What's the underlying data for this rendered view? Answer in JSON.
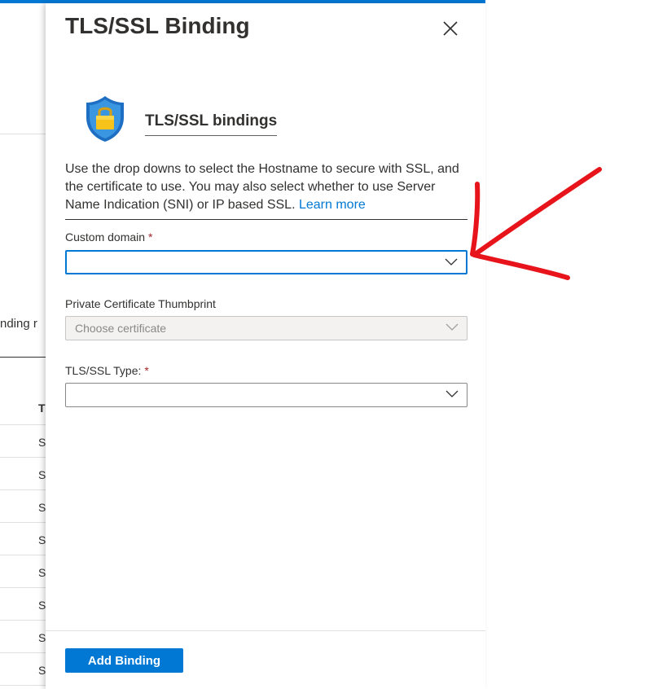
{
  "background": {
    "partial_label": "nding r",
    "column_header_partial": "T",
    "row_cells": [
      "S",
      "S",
      "S",
      "S",
      "S",
      "S",
      "S",
      "S"
    ]
  },
  "blade": {
    "title": "TLS/SSL Binding",
    "close_icon": "close-icon",
    "section_icon": "shield-lock-icon",
    "section_heading": "TLS/SSL bindings",
    "description": "Use the drop downs to select the Hostname to secure with SSL, and the certificate to use. You may also select whether to use Server Name Indication (SNI) or IP based SSL.",
    "learn_more": "Learn more",
    "fields": {
      "custom_domain": {
        "label": "Custom domain",
        "required_mark": "*",
        "value": ""
      },
      "certificate": {
        "label": "Private Certificate Thumbprint",
        "placeholder": "Choose certificate"
      },
      "ssl_type": {
        "label": "TLS/SSL Type:",
        "required_mark": "*",
        "value": ""
      }
    },
    "add_button": "Add Binding"
  },
  "colors": {
    "accent": "#0078d4",
    "required": "#a4262c",
    "annotation": "#e8141c"
  }
}
